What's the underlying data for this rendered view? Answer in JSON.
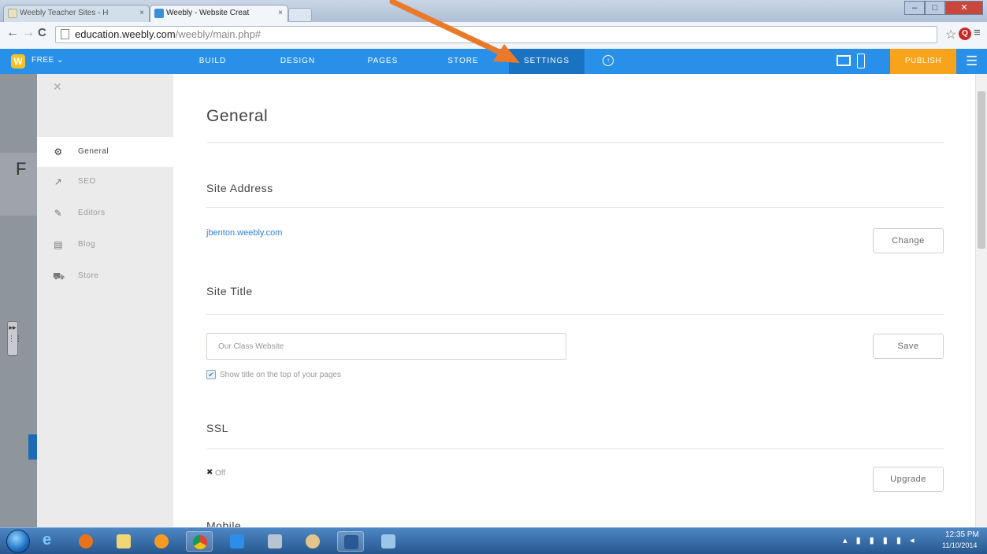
{
  "browser": {
    "tabs": [
      {
        "title": "Weebly Teacher Sites - H"
      },
      {
        "title": "Weebly - Website Creat"
      }
    ],
    "url_host": "education.weebly.com",
    "url_path": "/weebly/main.php#"
  },
  "weebly_nav": {
    "plan": "FREE ⌄",
    "items": [
      "BUILD",
      "DESIGN",
      "PAGES",
      "STORE",
      "SETTINGS"
    ],
    "publish": "PUBLISH"
  },
  "sidebar": {
    "items": [
      {
        "label": "General",
        "icon": "gear-icon"
      },
      {
        "label": "SEO",
        "icon": "trend-icon"
      },
      {
        "label": "Editors",
        "icon": "pencil-icon"
      },
      {
        "label": "Blog",
        "icon": "blog-icon"
      },
      {
        "label": "Store",
        "icon": "cart-icon"
      }
    ]
  },
  "editor_strip": {
    "letter": "F"
  },
  "settings": {
    "title": "General",
    "site_address": {
      "heading": "Site Address",
      "value": "jbenton.weebly.com",
      "button": "Change"
    },
    "site_title": {
      "heading": "Site Title",
      "value": "Our Class Website",
      "button": "Save",
      "checkbox_label": "Show title on the top of your pages",
      "checked": true
    },
    "ssl": {
      "heading": "SSL",
      "status": "Off",
      "button": "Upgrade"
    },
    "mobile": {
      "heading": "Mobile"
    }
  },
  "taskbar": {
    "clock_time": "12:35 PM",
    "clock_date": "11/10/2014"
  },
  "colors": {
    "weebly_blue": "#2990ea",
    "settings_active": "#1a72c3",
    "publish_orange": "#f8a31c",
    "arrow_orange": "#ea7a2a",
    "link_blue": "#2f82d8"
  }
}
